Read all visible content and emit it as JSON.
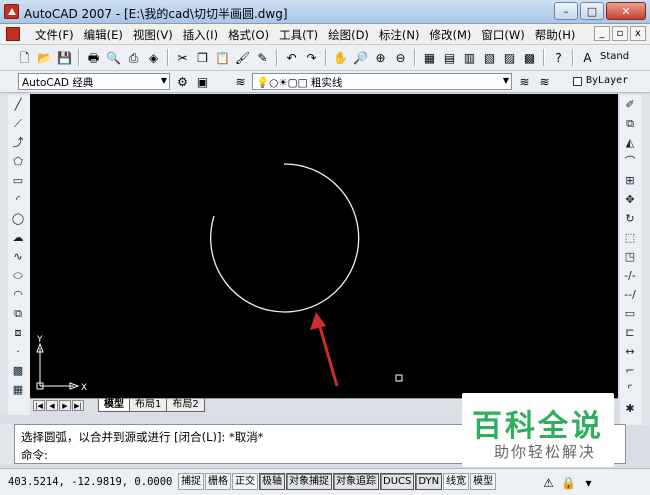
{
  "window": {
    "title": "AutoCAD 2007 - [E:\\我的cad\\切切半画圆.dwg]",
    "controls": {
      "minimize": "–",
      "maximize": "□",
      "close": "✕"
    }
  },
  "menubar": {
    "items": [
      "文件(F)",
      "编辑(E)",
      "视图(V)",
      "插入(I)",
      "格式(O)",
      "工具(T)",
      "绘图(D)",
      "标注(N)",
      "修改(M)",
      "窗口(W)",
      "帮助(H)"
    ],
    "doc_controls": [
      "_",
      "▫",
      "x"
    ]
  },
  "toolbar": {
    "standard_label": "Stand",
    "workspace_combo": "AutoCAD 经典",
    "layer_combo": "粗实线",
    "bylayer": "ByLayer"
  },
  "canvas": {
    "background": "#000000",
    "ucs_x": "X",
    "ucs_y": "Y"
  },
  "tabs": [
    "模型",
    "布局1",
    "布局2"
  ],
  "command": {
    "line1": "选择圆弧，以合并到源或进行 [闭合(L)]:  *取消*",
    "line2": "命令:"
  },
  "status": {
    "coords": "403.5214, -12.9819, 0.0000",
    "buttons": [
      "捕捉",
      "栅格",
      "正交",
      "极轴",
      "对象捕捉",
      "对象追踪",
      "DUCS",
      "DYN",
      "线宽",
      "模型"
    ]
  },
  "watermark": {
    "title": "百科全说",
    "subtitle": "助你轻松解决"
  },
  "colors": {
    "accent_arrow": "#d22b2b",
    "watermark_green": "#2eae5f"
  }
}
